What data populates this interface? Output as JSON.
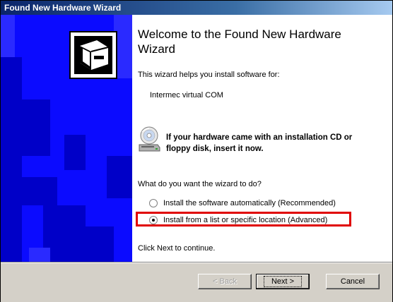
{
  "window": {
    "title": "Found New Hardware Wizard"
  },
  "content": {
    "heading": "Welcome to the Found New Hardware Wizard",
    "intro": "This wizard helps you install software for:",
    "device": "Intermec virtual COM",
    "cd_notice": "If your hardware came with an installation CD or floppy disk, insert it now.",
    "question": "What do you want the wizard to do?",
    "options": [
      {
        "label": "Install the software automatically (Recommended)",
        "selected": false
      },
      {
        "label": "Install from a list or specific location (Advanced)",
        "selected": true
      }
    ],
    "footer_note": "Click Next to continue."
  },
  "buttons": {
    "back": "< Back",
    "next": "Next >",
    "cancel": "Cancel"
  },
  "colors": {
    "side_panel": "#0b0bff",
    "highlight": "#e00000",
    "title_bar": "#0a246a"
  },
  "icons": {
    "side_panel": "hardware-box-icon",
    "cd": "cd-drive-icon"
  }
}
